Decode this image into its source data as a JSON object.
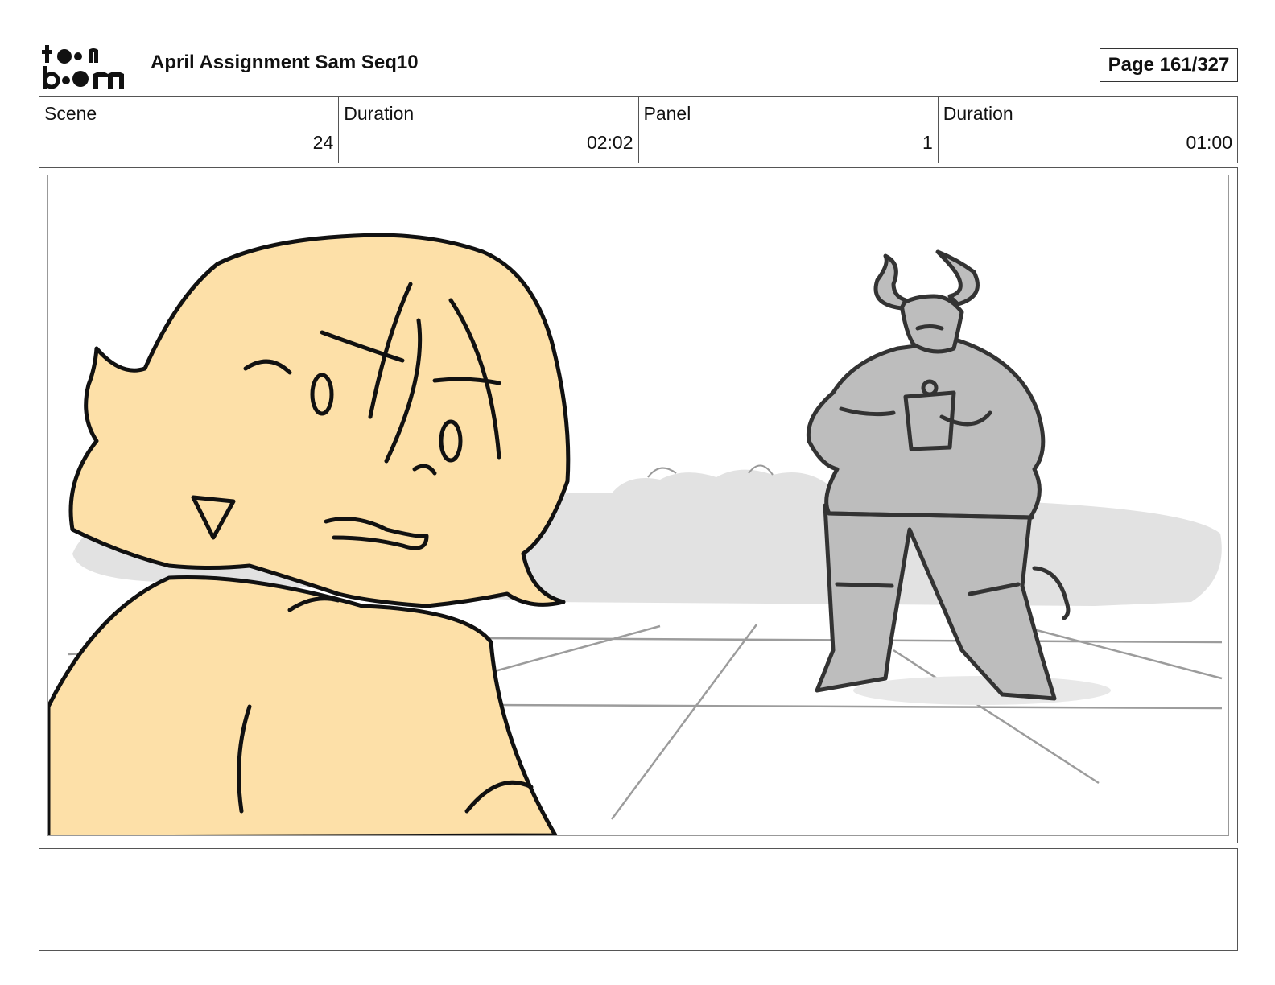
{
  "header": {
    "logo_text": "toon boom",
    "title": "April Assignment Sam Seq10",
    "page_label": "Page 161/327"
  },
  "info": {
    "scene_label": "Scene",
    "scene_value": "24",
    "scene_duration_label": "Duration",
    "scene_duration_value": "02:02",
    "panel_label": "Panel",
    "panel_value": "1",
    "panel_duration_label": "Duration",
    "panel_duration_value": "01:00"
  },
  "colors": {
    "skin_fill": "#FDE0A8",
    "figure_gray": "#BDBDBD",
    "bush_gray": "#E2E2E2",
    "line": "#111111"
  },
  "notes": ""
}
